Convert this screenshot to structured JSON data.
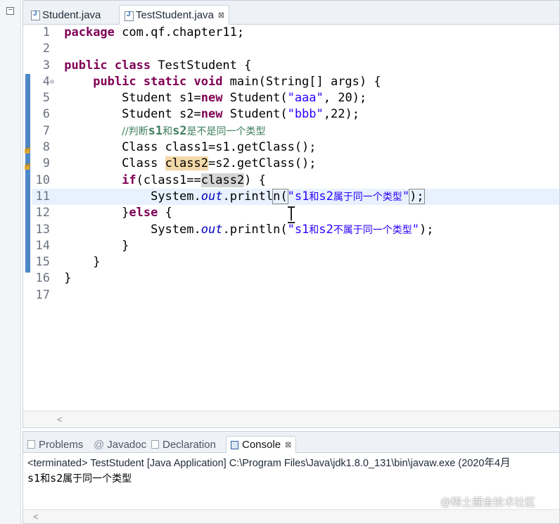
{
  "editor": {
    "tabs": [
      {
        "label": "Student.java"
      },
      {
        "label": "TestStudent.java",
        "close": "⊠"
      }
    ],
    "line_numbers": [
      "1",
      "2",
      "3",
      "4",
      "5",
      "6",
      "7",
      "8",
      "9",
      "10",
      "11",
      "12",
      "13",
      "14",
      "15",
      "16",
      "17"
    ],
    "code": {
      "l1_kw": "package",
      "l1_rest": " com.qf.chapter11;",
      "l3_kw": "public class",
      "l3_rest": " TestStudent {",
      "l4_kw": "public static void",
      "l4_rest": " main(String[] args) {",
      "l5_a": "Student s1=",
      "l5_kw": "new",
      "l5_b": " Student(",
      "l5_str": "\"aaa\"",
      "l5_c": ", 20);",
      "l6_a": "Student s2=",
      "l6_kw": "new",
      "l6_b": " Student(",
      "l6_str": "\"bbb\"",
      "l6_c": ",22);",
      "l7_comment_a": "//判断",
      "l7_comment_b": "s1",
      "l7_comment_c": "和",
      "l7_comment_d": "s2",
      "l7_comment_e": "是不是同一个类型",
      "l8_a": "Class ",
      "l8_occ": "class1",
      "l8_b": "=s1.getClass();",
      "l9_a": "Class ",
      "l9_occ": "class2",
      "l9_b": "=s2.getClass();",
      "l10_kw": "if",
      "l10_a": "(class1==",
      "l10_sel": "class2",
      "l10_b": ") {",
      "l11_a": "System.",
      "l11_fld": "out",
      "l11_b": ".printl",
      "l11_c": "n",
      "l11_str_a": "\"s1",
      "l11_str_b": "和",
      "l11_str_c": "s2",
      "l11_str_d": "属于同一个类型",
      "l11_str_e": "\"",
      "l11_end": ");",
      "l12_a": "}",
      "l12_kw": "else",
      "l12_b": " {",
      "l13_a": "System.",
      "l13_fld": "out",
      "l13_b": ".println(",
      "l13_str_a": "\"s1",
      "l13_str_b": "和",
      "l13_str_c": "s2",
      "l13_str_d": "不属于同一个类型",
      "l13_str_e": "\"",
      "l13_end": ");",
      "l14": "}",
      "l15": "}",
      "l16": "}"
    }
  },
  "console": {
    "tabs": [
      {
        "label": "Problems"
      },
      {
        "label": "Javadoc"
      },
      {
        "label": "Declaration"
      },
      {
        "label": "Console",
        "close": "⊠"
      }
    ],
    "terminated_line": "<terminated> TestStudent [Java Application] C:\\Program Files\\Java\\jdk1.8.0_131\\bin\\javaw.exe (2020年4月",
    "output_a": "s1",
    "output_b": "和",
    "output_c": "s2",
    "output_d": "属于同一个类型"
  },
  "watermark": "@稀土掘金技术社区",
  "colors": {
    "keyword": "#7f0055",
    "string": "#2a00ff",
    "comment": "#3f7f5f",
    "field": "#0000c0",
    "change_bar": "#4c88c8",
    "current_line": "#e8f2fe"
  }
}
